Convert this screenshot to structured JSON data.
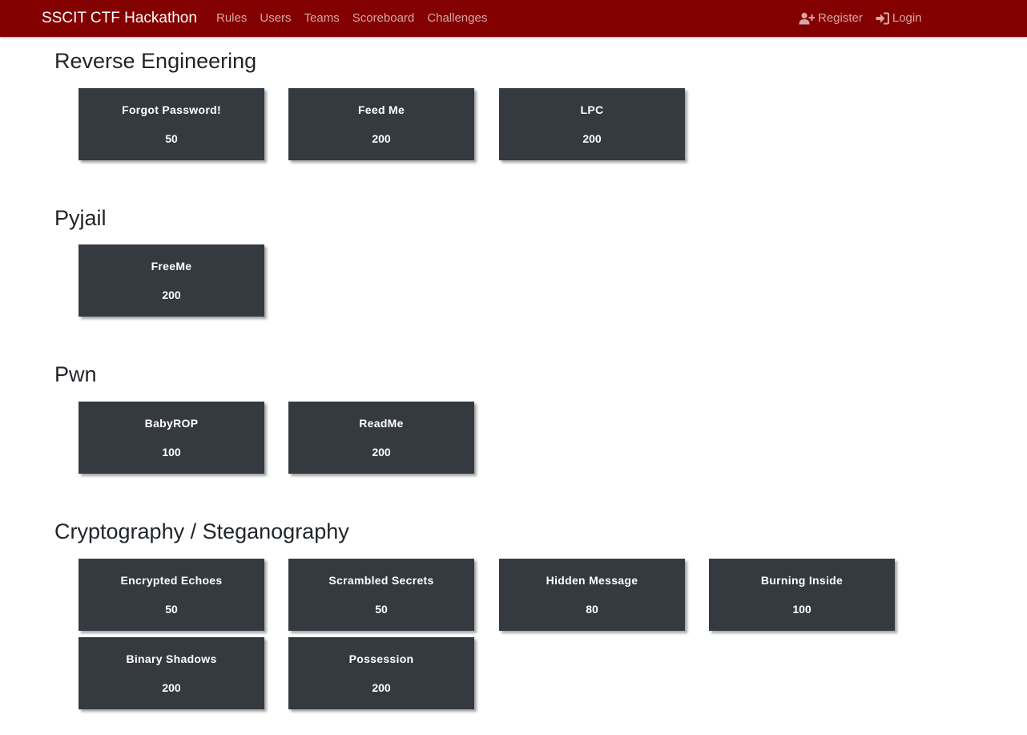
{
  "navbar": {
    "brand": "SSCIT CTF Hackathon",
    "links": [
      "Rules",
      "Users",
      "Teams",
      "Scoreboard",
      "Challenges"
    ],
    "register_label": "Register",
    "login_label": "Login",
    "background_color": "#830000",
    "link_color": "#d9a6a6"
  },
  "categories": [
    {
      "name": "Reverse Engineering",
      "challenges": [
        {
          "name": "Forgot Password!",
          "value": "50"
        },
        {
          "name": "Feed Me",
          "value": "200"
        },
        {
          "name": "LPC",
          "value": "200"
        }
      ]
    },
    {
      "name": "Pyjail",
      "challenges": [
        {
          "name": "FreeMe",
          "value": "200"
        }
      ]
    },
    {
      "name": "Pwn",
      "challenges": [
        {
          "name": "BabyROP",
          "value": "100"
        },
        {
          "name": "ReadMe",
          "value": "200"
        }
      ]
    },
    {
      "name": "Cryptography / Steganography",
      "challenges": [
        {
          "name": "Encrypted Echoes",
          "value": "50"
        },
        {
          "name": "Scrambled Secrets",
          "value": "50"
        },
        {
          "name": "Hidden Message",
          "value": "80"
        },
        {
          "name": "Burning Inside",
          "value": "100"
        },
        {
          "name": "Binary Shadows",
          "value": "200"
        },
        {
          "name": "Possession",
          "value": "200"
        }
      ]
    }
  ],
  "card_color": "#343a40",
  "icons": {
    "register": "user-plus-icon",
    "login": "sign-in-icon"
  }
}
